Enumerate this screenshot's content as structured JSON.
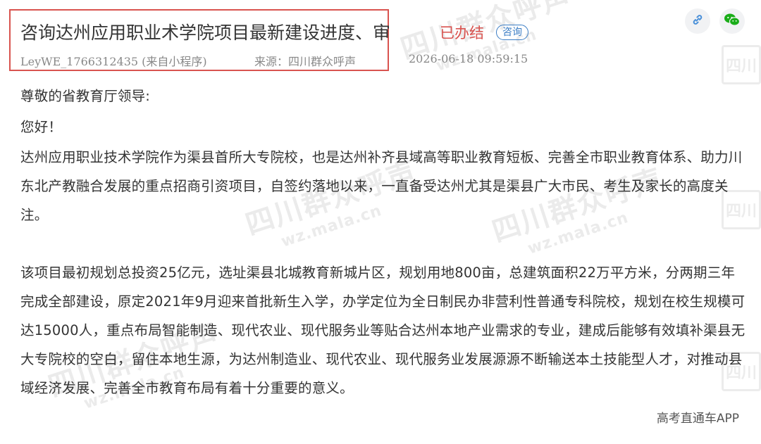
{
  "header": {
    "title": "咨询达州应用职业术学院项目最新建设进度、审",
    "status": "已办结",
    "badge": "咨询",
    "author": "LeyWE_1766312435 (来自小程序)",
    "source": "来源：四川群众呼声",
    "datetime": "2026-06-18 09:59:15"
  },
  "actions": {
    "link_icon": "link-icon",
    "wechat_icon": "wechat-icon"
  },
  "body": {
    "salutation": "尊敬的省教育厅领导:",
    "greeting": "您好！",
    "paragraph1": "达州应用职业技术学院作为渠县首所大专院校，也是达州补齐县域高等职业教育短板、完善全市职业教育体系、助力川东北产教融合发展的重点招商引资项目，自签约落地以来，一直备受达州尤其是渠县广大市民、考生及家长的高度关注。",
    "paragraph2": "该项目最初规划总投资25亿元，选址渠县北城教育新城片区，规划用地800亩，总建筑面积22万平方米，分两期三年完成全部建设，原定2021年9月迎来首批新生入学，办学定位为全日制民办非营利性普通专科院校，规划在校生规模可达15000人，重点布局智能制造、现代农业、现代服务业等贴合达州本地产业需求的专业，建成后能够有效填补渠县无大专院校的空白，留住本地生源，为达州制造业、现代农业、现代服务业发展源源不断输送本土技能型人才，对推动县域经济发展、完善全市教育布局有着十分重要的意义。"
  },
  "watermark": {
    "main": "四川群众呼声",
    "sub": "wz.mala.cn",
    "mark": "四川"
  },
  "footer": {
    "app_label": "高考直通车APP"
  },
  "colors": {
    "status_red": "#d9534f",
    "badge_blue": "#3b7dc4",
    "wechat_green": "#1aad19",
    "link_blue": "#4a90d9"
  }
}
